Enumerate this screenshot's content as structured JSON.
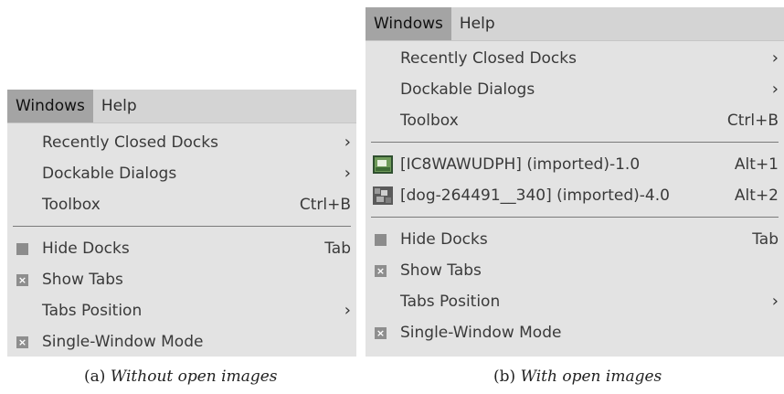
{
  "panel_a": {
    "menubar": [
      {
        "label": "Windows",
        "active": true
      },
      {
        "label": "Help",
        "active": false
      }
    ],
    "items_top": [
      {
        "label": "Recently Closed Docks",
        "submenu": true
      },
      {
        "label": "Dockable Dialogs",
        "submenu": true
      },
      {
        "label": "Toolbox",
        "accel": "Ctrl+B"
      }
    ],
    "items_bottom": [
      {
        "label": "Hide Docks",
        "accel": "Tab",
        "icon": "square-icon"
      },
      {
        "label": "Show Tabs",
        "icon": "checkbox-checked-icon"
      },
      {
        "label": "Tabs Position",
        "submenu": true
      },
      {
        "label": "Single-Window Mode",
        "icon": "checkbox-checked-icon"
      }
    ],
    "caption": {
      "prefix": "(a)",
      "text": "Without open images"
    }
  },
  "panel_b": {
    "menubar": [
      {
        "label": "Windows",
        "active": true
      },
      {
        "label": "Help",
        "active": false
      }
    ],
    "items_top": [
      {
        "label": "Recently Closed Docks",
        "submenu": true
      },
      {
        "label": "Dockable Dialogs",
        "submenu": true
      },
      {
        "label": "Toolbox",
        "accel": "Ctrl+B"
      }
    ],
    "images": [
      {
        "label": "[IC8WAWUDPH] (imported)-1.0",
        "accel": "Alt+1",
        "icon": "image-thumbnail-icon"
      },
      {
        "label": "[dog-264491__340] (imported)-4.0",
        "accel": "Alt+2",
        "icon": "image-thumbnail-icon"
      }
    ],
    "items_bottom": [
      {
        "label": "Hide Docks",
        "accel": "Tab",
        "icon": "square-icon"
      },
      {
        "label": "Show Tabs",
        "icon": "checkbox-checked-icon"
      },
      {
        "label": "Tabs Position",
        "submenu": true
      },
      {
        "label": "Single-Window Mode",
        "icon": "checkbox-checked-icon"
      }
    ],
    "caption": {
      "prefix": "(b)",
      "text": "With open images"
    }
  },
  "glyphs": {
    "arrow": "›",
    "check": "×"
  }
}
